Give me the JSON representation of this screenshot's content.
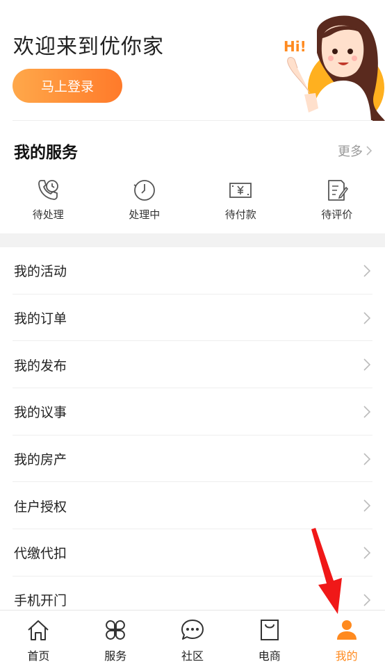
{
  "header": {
    "welcome": "欢迎来到优你家",
    "login_label": "马上登录",
    "mascot_text": "Hi!"
  },
  "services": {
    "title": "我的服务",
    "more_label": "更多",
    "items": [
      {
        "label": "待处理",
        "icon": "phone-clock-icon"
      },
      {
        "label": "处理中",
        "icon": "clock-icon"
      },
      {
        "label": "待付款",
        "icon": "yen-bill-icon"
      },
      {
        "label": "待评价",
        "icon": "edit-document-icon"
      }
    ]
  },
  "menu": {
    "items": [
      {
        "label": "我的活动"
      },
      {
        "label": "我的订单"
      },
      {
        "label": "我的发布"
      },
      {
        "label": "我的议事"
      },
      {
        "label": "我的房产"
      },
      {
        "label": "住户授权"
      },
      {
        "label": "代缴代扣"
      },
      {
        "label": "手机开门"
      }
    ]
  },
  "nav": {
    "items": [
      {
        "label": "首页",
        "icon": "home-icon"
      },
      {
        "label": "服务",
        "icon": "grid-icon"
      },
      {
        "label": "社区",
        "icon": "chat-bubble-icon"
      },
      {
        "label": "电商",
        "icon": "shopping-bag-icon"
      },
      {
        "label": "我的",
        "icon": "person-icon",
        "active": true
      }
    ]
  },
  "colors": {
    "accent": "#ff8a1f",
    "login_gradient_start": "#ffa84a",
    "login_gradient_end": "#ff7a2a",
    "annotation_arrow": "#f01818"
  }
}
